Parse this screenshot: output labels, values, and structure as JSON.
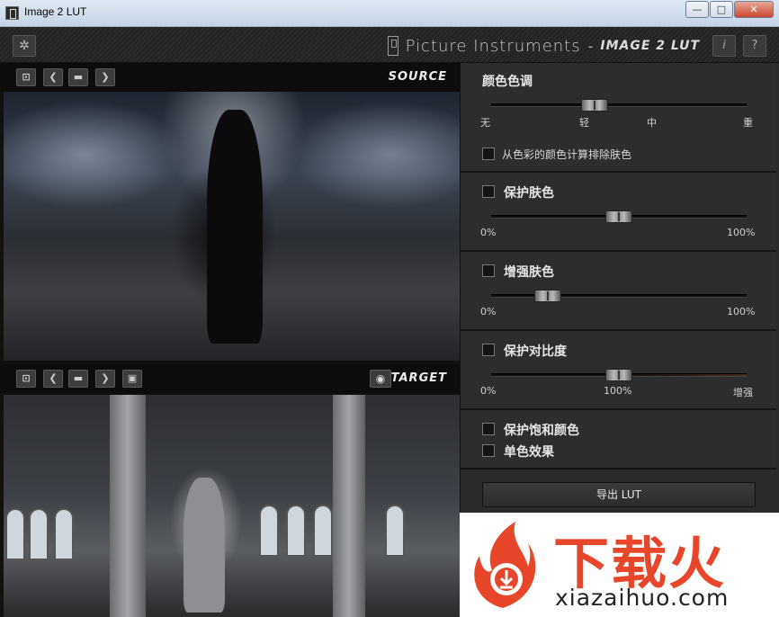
{
  "window": {
    "title": "Image 2 LUT",
    "minimize": "—",
    "maximize": "□",
    "close": "✕"
  },
  "header": {
    "brand_name": "Picture Instruments",
    "separator": "-",
    "product": "IMAGE 2 LUT",
    "info_label": "i",
    "help_label": "?"
  },
  "source": {
    "label": "SOURCE"
  },
  "target": {
    "label": "TARGET"
  },
  "icons": {
    "settings": "gear-icon",
    "load": "load-icon",
    "prev": "chevron-left-icon",
    "folder": "folder-icon",
    "next": "chevron-right-icon",
    "save": "save-icon",
    "eye": "eye-icon"
  },
  "controls": {
    "color_tone": {
      "title": "颜色色调",
      "value": 0.41,
      "ticks": [
        "无",
        "轻",
        "中",
        "重"
      ],
      "exclude_skin": {
        "label": "从色彩的颜色计算排除肤色",
        "checked": false
      }
    },
    "protect_skin": {
      "label": "保护肤色",
      "checked": false,
      "value": 0.5,
      "min": "0%",
      "max": "100%"
    },
    "enhance_skin": {
      "label": "增强肤色",
      "checked": false,
      "value": 0.22,
      "min": "0%",
      "max": "100%"
    },
    "protect_contrast": {
      "label": "保护对比度",
      "checked": false,
      "value": 0.5,
      "min": "0%",
      "mid": "100%",
      "max": "增强"
    },
    "protect_saturation": {
      "label": "保护饱和颜色",
      "checked": false
    },
    "monochrome": {
      "label": "单色效果",
      "checked": false
    },
    "export": {
      "label": "导出 LUT"
    }
  },
  "watermark": {
    "cn": "下载火",
    "url": "xiazaihuo.com"
  },
  "colors": {
    "accent": "#e8462b",
    "panel": "#2d2d2d",
    "divider": "#161616"
  }
}
